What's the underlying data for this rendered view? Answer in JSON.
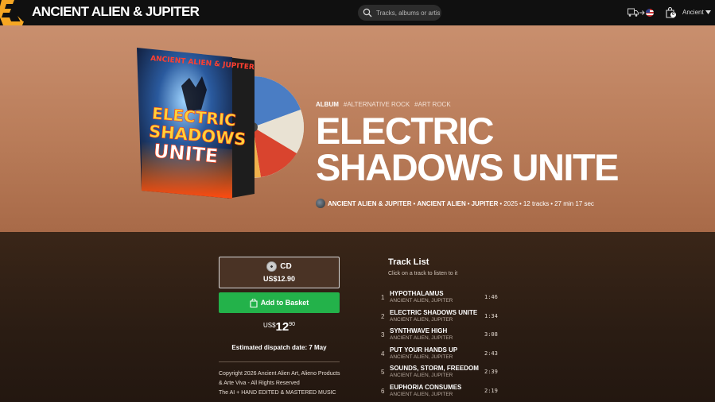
{
  "header": {
    "brand": "ANCIENT ALIEN & JUPITER",
    "search_placeholder": "Tracks, albums or artists...",
    "basket_count": "0",
    "user_label": "Ancient"
  },
  "album": {
    "type": "ALBUM",
    "tags": [
      "#ALTERNATIVE ROCK",
      "#ART ROCK"
    ],
    "title": "ELECTRIC SHADOWS UNITE",
    "cover_text": {
      "artist": "ANCIENT ALIEN & JUPITER",
      "title_line1": "ELECTRIC",
      "title_line2": "SHADOWS",
      "title_line3": "UNITE"
    },
    "credits": {
      "artist": "ANCIENT ALIEN & JUPITER",
      "artist2": "ANCIENT ALIEN",
      "artist3": "JUPITER",
      "year": "2025",
      "tracks": "12 tracks",
      "duration": "27 min 17 sec",
      "separator": "•"
    }
  },
  "purchase": {
    "format": "CD",
    "format_price": "US$12.90",
    "add_button": "Add to Basket",
    "price_currency": "US$",
    "price_int": "12",
    "price_dec": "90",
    "dispatch": "Estimated dispatch date: 7 May",
    "copyright_line1": "Copyright 2026 Ancient Alien Art, Alieno Products",
    "copyright_line2": "& Arte Viva - All Rights Reserved",
    "copyright_line3": "The AI + HAND EDITED & MASTERED MUSIC"
  },
  "tracklist": {
    "heading": "Track List",
    "subheading": "Click on a track to listen to it",
    "tracks": [
      {
        "num": "1",
        "name": "HYPOTHALAMUS",
        "artist": "ANCIENT ALIEN, JUPITER",
        "duration": "1:46"
      },
      {
        "num": "2",
        "name": "ELECTRIC SHADOWS UNITE",
        "artist": "ANCIENT ALIEN, JUPITER",
        "duration": "1:34"
      },
      {
        "num": "3",
        "name": "SYNTHWAVE HIGH",
        "artist": "ANCIENT ALIEN, JUPITER",
        "duration": "3:08"
      },
      {
        "num": "4",
        "name": "PUT YOUR HANDS UP",
        "artist": "ANCIENT ALIEN, JUPITER",
        "duration": "2:43"
      },
      {
        "num": "5",
        "name": "SOUNDS, STORM, FREEDOM",
        "artist": "ANCIENT ALIEN, JUPITER",
        "duration": "2:39"
      },
      {
        "num": "6",
        "name": "EUPHORIA CONSUMES",
        "artist": "ANCIENT ALIEN, JUPITER",
        "duration": "2:19"
      }
    ]
  },
  "colors": {
    "accent": "#f5a623",
    "button_green": "#23b24a",
    "hero_top": "#c98f6e"
  },
  "icons": [
    "logo-icon",
    "search-icon",
    "shipping-icon",
    "flag-icon",
    "basket-icon",
    "chevron-down-icon",
    "cd-icon",
    "bag-icon"
  ]
}
